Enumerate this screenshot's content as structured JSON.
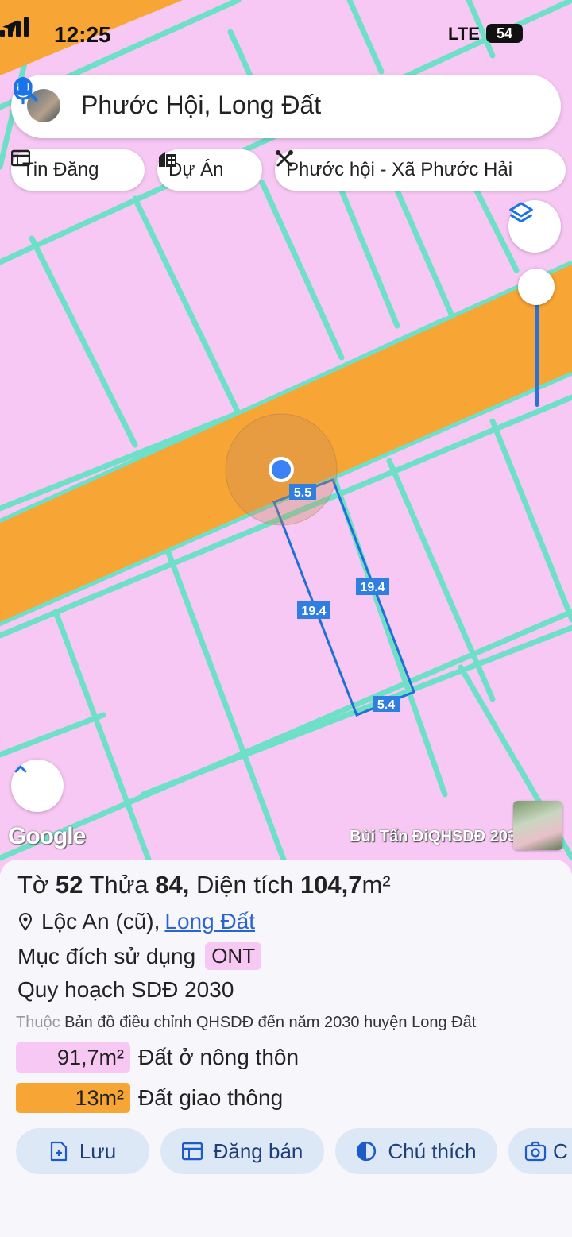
{
  "status_bar": {
    "time": "12:25",
    "network": "LTE",
    "battery": "54"
  },
  "search": {
    "query": "Phước Hội, Long Đất"
  },
  "chips": [
    {
      "label": "Tin Đăng",
      "icon": "listing-icon"
    },
    {
      "label": "Dự Án",
      "icon": "building-icon"
    },
    {
      "label": "Phước hội - Xã Phước Hải",
      "icon": "tools-icon"
    }
  ],
  "map": {
    "parcel_labels": {
      "top": "5.5",
      "left": "19.4",
      "right": "19.4",
      "bottom": "5.4"
    },
    "google_logo": "Google",
    "credit": "Bùi Tấn ĐiQHSDĐ 2030",
    "colors": {
      "residential": "#f8c8f4",
      "road": "#f7a535",
      "grid": "#6fe0c8",
      "parcel": "#1f6fd4"
    }
  },
  "panel": {
    "title_prefix": "Tờ",
    "sheet": "52",
    "parcel_word": "Thửa",
    "parcel": "84,",
    "area_word": "Diện tích",
    "area": "104,7",
    "area_unit": "m²",
    "locality": "Lộc An (cũ),",
    "district": "Long Đất",
    "purpose_label": "Mục đích sử dụng",
    "purpose_code": "ONT",
    "plan_label": "Quy hoạch SDĐ 2030",
    "source_muted": "Thuộc",
    "source_text": "Bản đồ điều chỉnh QHSDĐ đến năm 2030 huyện Long Đất",
    "legend": [
      {
        "amount": "91,7m²",
        "label": "Đất ở nông thôn",
        "color": "#f8c8f4"
      },
      {
        "amount": "13m²",
        "label": "Đất giao thông",
        "color": "#f7a535"
      }
    ]
  },
  "actions": [
    {
      "label": "Lưu",
      "icon": "save-icon"
    },
    {
      "label": "Đăng bán",
      "icon": "listing-icon"
    },
    {
      "label": "Chú thích",
      "icon": "contrast-icon"
    },
    {
      "label": "C",
      "icon": "camera-icon"
    }
  ]
}
